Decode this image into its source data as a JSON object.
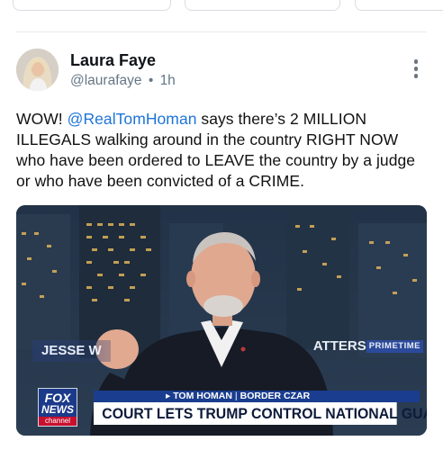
{
  "post": {
    "author_name": "Laura Faye",
    "author_handle": "@laurafaye",
    "separator": "•",
    "time_ago": "1h",
    "text_before": "WOW! ",
    "mention": "@RealTomHoman",
    "text_after": " says there’s 2 MILLION ILLEGALS walking around in the country RIGHT NOW who have been ordered to LEAVE the country by a judge or who have been convicted of a CRIME."
  },
  "media": {
    "show_left": "JESSE W",
    "show_right": "ATTERS",
    "show_badge": "PRIMETIME",
    "chyron_name": "▸ TOM HOMAN",
    "chyron_divider": "|",
    "chyron_role": "BORDER CZAR",
    "chyron_headline": "COURT LETS TRUMP CONTROL NATIONAL GUARD",
    "logo_line1": "FOX",
    "logo_line2": "NEWS",
    "logo_line3": "channel"
  },
  "icons": {
    "more": "vertical-ellipsis-icon",
    "avatar": "user-avatar"
  },
  "colors": {
    "mention": "#1d74d8",
    "meta_text": "#657786",
    "chyron_blue": "#1a3d8f"
  }
}
